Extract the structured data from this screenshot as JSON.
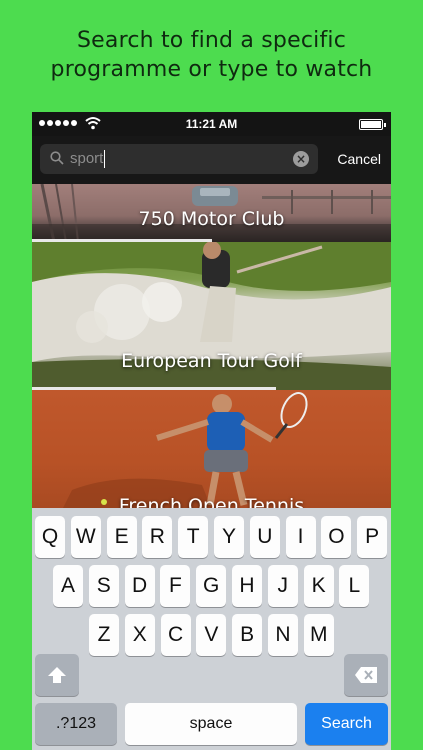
{
  "promo": {
    "line1": "Search to find a specific",
    "line2": "programme or type to watch"
  },
  "status_bar": {
    "time": "11:21 AM",
    "signal_icon": "signal-dots-icon",
    "wifi_icon": "wifi-icon",
    "battery_icon": "battery-icon"
  },
  "search": {
    "value": "sport",
    "clear_icon": "clear-icon",
    "cancel_label": "Cancel"
  },
  "results": [
    {
      "title": "750 Motor Club",
      "progress": 0.5
    },
    {
      "title": "European Tour Golf",
      "progress": 0.68
    },
    {
      "title": "French Open Tennis",
      "progress": 0
    }
  ],
  "keyboard": {
    "row1": [
      "Q",
      "W",
      "E",
      "R",
      "T",
      "Y",
      "U",
      "I",
      "O",
      "P"
    ],
    "row2": [
      "A",
      "S",
      "D",
      "F",
      "G",
      "H",
      "J",
      "K",
      "L"
    ],
    "row3": [
      "Z",
      "X",
      "C",
      "V",
      "B",
      "N",
      "M"
    ],
    "numbers_label": ".?123",
    "space_label": "space",
    "search_label": "Search",
    "shift_icon": "shift-icon",
    "backspace_icon": "backspace-icon"
  },
  "colors": {
    "background": "#4ddc4f",
    "search_key": "#1b80ef"
  }
}
